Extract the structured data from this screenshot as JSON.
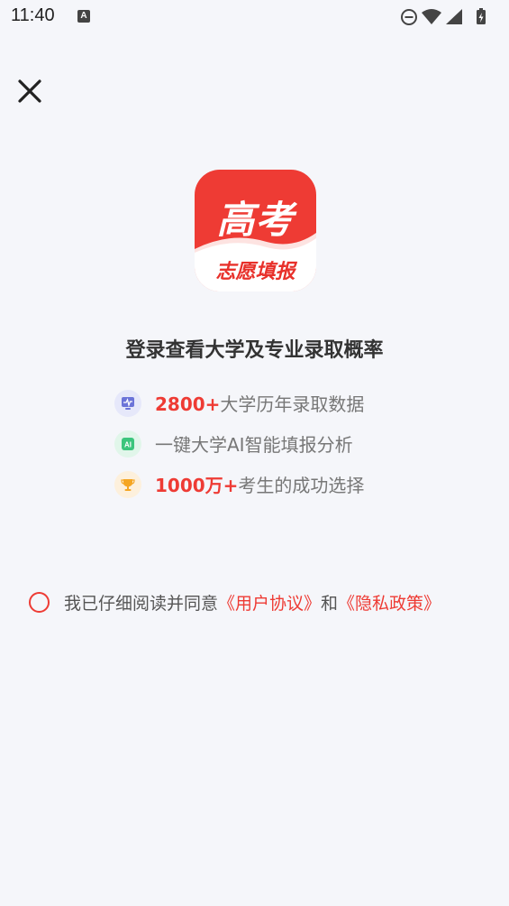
{
  "status_bar": {
    "time": "11:40",
    "notification_icon_letter": "A",
    "icons": [
      "dnd-icon",
      "wifi-icon",
      "signal-icon",
      "battery-icon"
    ]
  },
  "header": {
    "close_icon": "close-icon"
  },
  "logo": {
    "top_text": "高考",
    "bottom_text": "志愿填报",
    "brand_color": "#ee3b34"
  },
  "headline": "登录查看大学及专业录取概率",
  "features": [
    {
      "icon": "chart-monitor-icon",
      "highlight": "2800+",
      "text": "大学历年录取数据",
      "icon_color": "#6b73d8",
      "icon_bg": "#e6e8fa"
    },
    {
      "icon": "ai-icon",
      "highlight": "",
      "text": "一键大学AI智能填报分析",
      "icon_color": "#3cc57d",
      "icon_bg": "#e1f6ea"
    },
    {
      "icon": "trophy-icon",
      "highlight": "1000万+",
      "text": "考生的成功选择",
      "icon_color": "#f5a623",
      "icon_bg": "#fdf0dc"
    }
  ],
  "agreement": {
    "prefix": "我已仔细阅读并同意",
    "user_agreement": "《用户协议》",
    "conjunction": "和",
    "privacy_policy": "《隐私政策》",
    "checked": false
  }
}
